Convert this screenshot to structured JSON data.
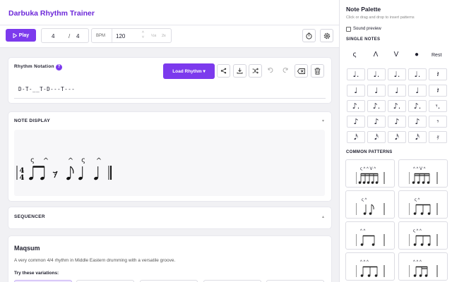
{
  "app": {
    "title": "Darbuka Rhythm Trainer"
  },
  "toolbar": {
    "play_label": "Play",
    "time_signature": {
      "numerator": "4",
      "separator": "/",
      "denominator": "4"
    },
    "bpm_label": "BPM",
    "bpm_value": "120",
    "bpm_half": "½x",
    "bpm_double": "2x",
    "icons": [
      "play-icon",
      "metronome-icon",
      "settings-icon"
    ]
  },
  "notation": {
    "title": "Rhythm Notation",
    "help": "?",
    "load_button": "Load Rhythm ▾",
    "rhythm_text": "D-T-__T-D---T---",
    "action_icons": [
      "share-icon",
      "download-icon",
      "shuffle-icon",
      "undo-icon",
      "redo-icon",
      "clear-icon",
      "trash-icon"
    ]
  },
  "note_display": {
    "title": "NOTE DISPLAY",
    "chevron": "▾",
    "time_signature": {
      "top": "4",
      "bottom": "4"
    },
    "stroke_marks": [
      "ς",
      "^",
      "^",
      "ς",
      "^"
    ]
  },
  "sequencer": {
    "title": "SEQUENCER",
    "chevron": "▴"
  },
  "rhythm_info": {
    "name": "Maqsum",
    "description": "A very common 4/4 rhythm in Middle Eastern drumming with a versatile groove.",
    "variations_label": "Try these variations:"
  },
  "palette": {
    "title": "Note Palette",
    "subtitle": "Click or drag and drop to insert patterns",
    "sound_preview": "Sound preview",
    "sound_preview_checked": false,
    "single_notes_label": "SINGLE NOTES",
    "stroke_glyphs": [
      "ς",
      "Λ",
      "V",
      "●"
    ],
    "rest_label": "Rest",
    "common_patterns_label": "COMMON PATTERNS",
    "patterns": [
      {
        "marks": "ς ^ ^ V ^"
      },
      {
        "marks": "^ ^ V ^"
      },
      {
        "marks": "ς ^"
      },
      {
        "marks": "ς ^"
      },
      {
        "marks": "^ ^"
      },
      {
        "marks": "ς ^ ^"
      },
      {
        "marks": "^ ^ ^"
      },
      {
        "marks": "^ ^ ^"
      }
    ]
  },
  "colors": {
    "accent": "#7c3aed",
    "title": "#6d28d9"
  }
}
